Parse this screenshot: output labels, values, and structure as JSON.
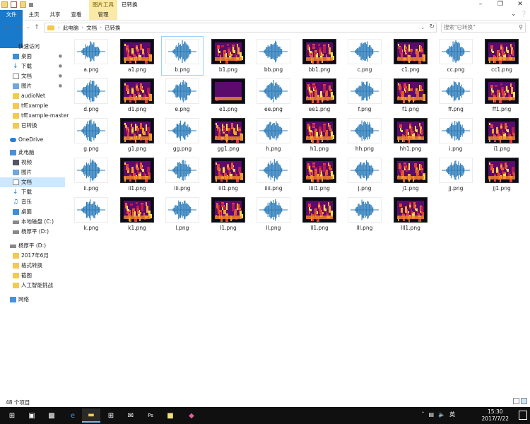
{
  "window": {
    "context_tab": "图片工具",
    "title": "已转换"
  },
  "ribbon": {
    "tabs": [
      "文件",
      "主页",
      "共享",
      "查看",
      "管理"
    ]
  },
  "address": {
    "crumbs": [
      "此电脑",
      "文档",
      "已转换"
    ],
    "search_placeholder": "搜索\"已转换\""
  },
  "nav": {
    "quick_access": "快速访问",
    "pinned": [
      "桌面",
      "下载",
      "文档",
      "图片"
    ],
    "recent": [
      "audioNet",
      "tfExample",
      "tfExample-master",
      "已转换"
    ],
    "onedrive": "OneDrive",
    "this_pc": "此电脑",
    "pc_items": [
      "视频",
      "图片",
      "文档",
      "下载",
      "音乐",
      "桌面",
      "本地磁盘 (C:)",
      "杨厚平 (D:)"
    ],
    "drive_d": "杨厚平 (D:)",
    "d_items": [
      "2017年6月",
      "格式转换",
      "截图",
      "人工智能挑战"
    ],
    "network": "网络"
  },
  "files": [
    {
      "name": "a.png",
      "kind": "wave"
    },
    {
      "name": "a1.png",
      "kind": "spec"
    },
    {
      "name": "b.png",
      "kind": "wave"
    },
    {
      "name": "b1.png",
      "kind": "spec"
    },
    {
      "name": "bb.png",
      "kind": "wave"
    },
    {
      "name": "bb1.png",
      "kind": "spec"
    },
    {
      "name": "c.png",
      "kind": "wave"
    },
    {
      "name": "c1.png",
      "kind": "spec"
    },
    {
      "name": "cc.png",
      "kind": "wave"
    },
    {
      "name": "cc1.png",
      "kind": "spec"
    },
    {
      "name": "d.png",
      "kind": "wave"
    },
    {
      "name": "d1.png",
      "kind": "spec"
    },
    {
      "name": "e.png",
      "kind": "wave"
    },
    {
      "name": "e1.png",
      "kind": "spec"
    },
    {
      "name": "ee.png",
      "kind": "wave"
    },
    {
      "name": "ee1.png",
      "kind": "spec"
    },
    {
      "name": "f.png",
      "kind": "wave"
    },
    {
      "name": "f1.png",
      "kind": "spec"
    },
    {
      "name": "ff.png",
      "kind": "wave"
    },
    {
      "name": "ff1.png",
      "kind": "spec"
    },
    {
      "name": "g.png",
      "kind": "wave"
    },
    {
      "name": "g1.png",
      "kind": "spec"
    },
    {
      "name": "gg.png",
      "kind": "wave"
    },
    {
      "name": "gg1.png",
      "kind": "spec"
    },
    {
      "name": "h.png",
      "kind": "wave"
    },
    {
      "name": "h1.png",
      "kind": "spec"
    },
    {
      "name": "hh.png",
      "kind": "wave"
    },
    {
      "name": "hh1.png",
      "kind": "spec"
    },
    {
      "name": "i.png",
      "kind": "wave"
    },
    {
      "name": "i1.png",
      "kind": "spec"
    },
    {
      "name": "ii.png",
      "kind": "wave"
    },
    {
      "name": "ii1.png",
      "kind": "spec"
    },
    {
      "name": "iii.png",
      "kind": "wave"
    },
    {
      "name": "iii1.png",
      "kind": "spec"
    },
    {
      "name": "iiii.png",
      "kind": "wave"
    },
    {
      "name": "iiii1.png",
      "kind": "spec"
    },
    {
      "name": "j.png",
      "kind": "wave"
    },
    {
      "name": "j1.png",
      "kind": "spec"
    },
    {
      "name": "jj.png",
      "kind": "wave"
    },
    {
      "name": "jj1.png",
      "kind": "spec"
    },
    {
      "name": "k.png",
      "kind": "wave"
    },
    {
      "name": "k1.png",
      "kind": "spec"
    },
    {
      "name": "l.png",
      "kind": "wave"
    },
    {
      "name": "l1.png",
      "kind": "spec"
    },
    {
      "name": "ll.png",
      "kind": "wave"
    },
    {
      "name": "ll1.png",
      "kind": "spec"
    },
    {
      "name": "lll.png",
      "kind": "wave"
    },
    {
      "name": "lll1.png",
      "kind": "spec"
    }
  ],
  "selected_file": "b.png",
  "status": {
    "count": "48 个项目"
  },
  "taskbar": {
    "time": "15:30",
    "date": "2017/7/22",
    "ime": "英",
    "icons": [
      "windows-icon",
      "task-view-icon",
      "terminal-icon",
      "edge-icon",
      "explorer-icon",
      "store-icon",
      "mail-icon",
      "photoshop-icon",
      "notes-icon",
      "paint-icon"
    ]
  },
  "colors": {
    "accent": "#1979ca",
    "wave": "#2b7bb9",
    "context": "#fbe9a6"
  }
}
